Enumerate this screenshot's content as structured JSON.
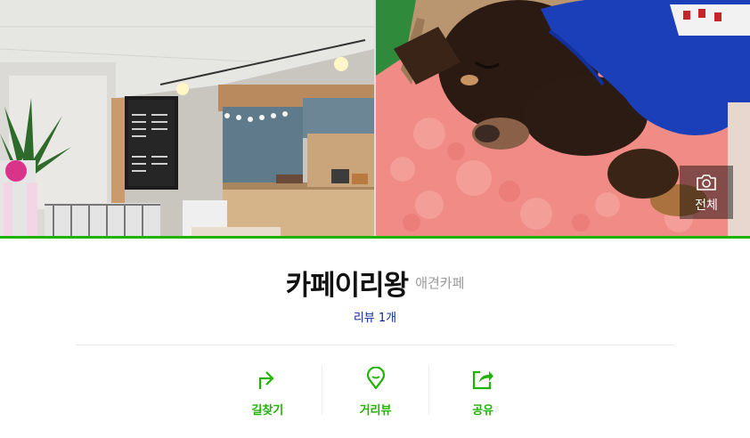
{
  "gallery": {
    "photos": [
      {
        "alt": "cafe-interior-photo"
      },
      {
        "alt": "sleeping-dog-photo"
      }
    ],
    "view_all_label": "전체"
  },
  "place": {
    "name": "카페이리왕",
    "category": "애견카페",
    "review_label": "리뷰 1개"
  },
  "actions": [
    {
      "label": "길찾기",
      "icon": "directions-icon"
    },
    {
      "label": "거리뷰",
      "icon": "street-view-pin-icon"
    },
    {
      "label": "공유",
      "icon": "share-icon"
    }
  ],
  "colors": {
    "accent_green": "#1fb300",
    "review_link": "#0b2b9a",
    "category_gray": "#999999"
  }
}
